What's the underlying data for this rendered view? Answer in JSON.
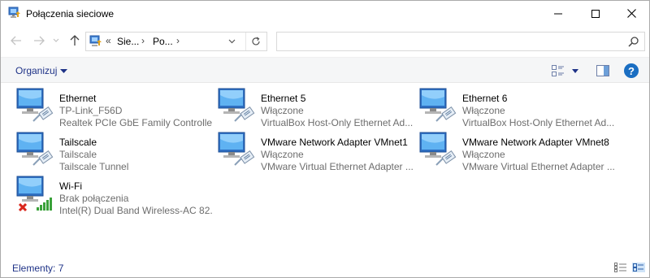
{
  "window": {
    "title": "Połączenia sieciowe"
  },
  "address": {
    "prefix": "«",
    "crumbs": [
      "Sie...",
      "Po..."
    ]
  },
  "search": {
    "placeholder": ""
  },
  "toolbar": {
    "organize_label": "Organizuj"
  },
  "connections": [
    {
      "name": "Ethernet",
      "status": "TP-Link_F56D",
      "device": "Realtek PCIe GbE Family Controller",
      "type": "wired",
      "state": "connected"
    },
    {
      "name": "Ethernet 5",
      "status": "Włączone",
      "device": "VirtualBox Host-Only Ethernet Ad...",
      "type": "wired",
      "state": "connected"
    },
    {
      "name": "Ethernet 6",
      "status": "Włączone",
      "device": "VirtualBox Host-Only Ethernet Ad...",
      "type": "wired",
      "state": "connected"
    },
    {
      "name": "Tailscale",
      "status": "Tailscale",
      "device": "Tailscale Tunnel",
      "type": "wired",
      "state": "connected"
    },
    {
      "name": "VMware Network Adapter VMnet1",
      "status": "Włączone",
      "device": "VMware Virtual Ethernet Adapter ...",
      "type": "wired",
      "state": "connected"
    },
    {
      "name": "VMware Network Adapter VMnet8",
      "status": "Włączone",
      "device": "VMware Virtual Ethernet Adapter ...",
      "type": "wired",
      "state": "connected"
    },
    {
      "name": "Wi-Fi",
      "status": "Brak połączenia",
      "device": "Intel(R) Dual Band Wireless-AC 82...",
      "type": "wireless",
      "state": "disconnected"
    }
  ],
  "statusbar": {
    "count_text": "Elementy: 7"
  },
  "colors": {
    "accent": "#1e3287",
    "help": "#1a6ec2",
    "secondary_text": "#6d6d6d",
    "error": "#d9261c",
    "signal": "#3aa13a"
  }
}
